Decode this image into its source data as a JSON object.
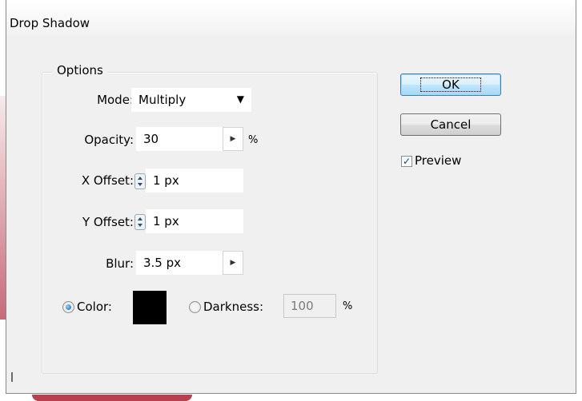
{
  "window": {
    "title": "Drop Shadow"
  },
  "options_group": {
    "label": "Options",
    "mode": {
      "label": "Mode:",
      "value": "Multiply"
    },
    "opacity": {
      "label": "Opacity:",
      "value": "30",
      "unit": "%"
    },
    "x_offset": {
      "label": "X Offset:",
      "value": "1 px"
    },
    "y_offset": {
      "label": "Y Offset:",
      "value": "1 px"
    },
    "blur": {
      "label": "Blur:",
      "value": "3.5 px"
    },
    "color_option": {
      "label": "Color:",
      "selected": true,
      "swatch": "#000000"
    },
    "darkness_option": {
      "label": "Darkness:",
      "selected": false,
      "value": "100",
      "unit": "%"
    }
  },
  "buttons": {
    "ok": "OK",
    "cancel": "Cancel"
  },
  "preview": {
    "label": "Preview",
    "checked": true
  }
}
